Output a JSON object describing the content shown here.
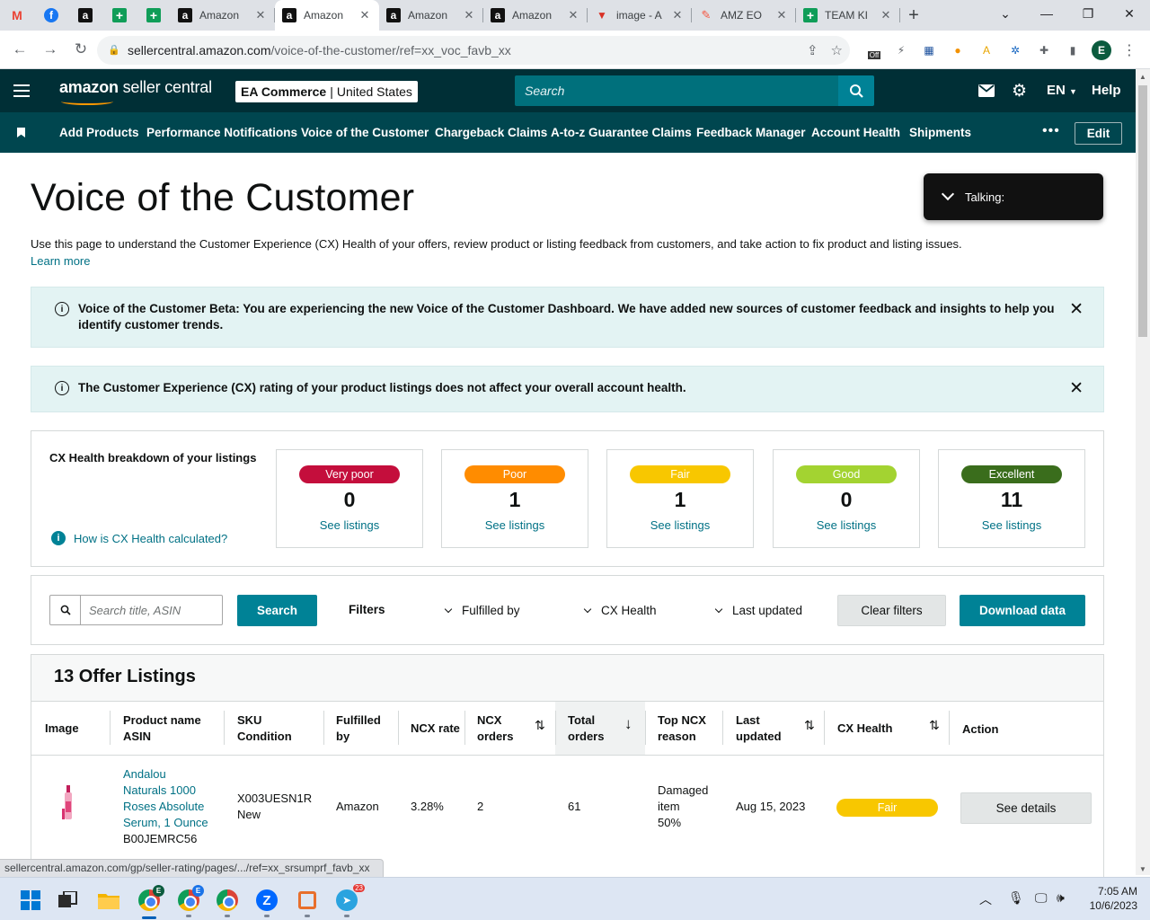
{
  "browser": {
    "tabs": [
      {
        "label": "",
        "icon": "gmail-icon"
      },
      {
        "label": "",
        "icon": "facebook-icon"
      },
      {
        "label": "",
        "icon": "amazon-icon"
      },
      {
        "label": "",
        "icon": "google-sheets-icon"
      },
      {
        "label": "",
        "icon": "google-sheets-icon"
      },
      {
        "label": "Amazon",
        "icon": "amazon-icon"
      },
      {
        "label": "Amazon",
        "icon": "amazon-icon",
        "active": true
      },
      {
        "label": "Amazon",
        "icon": "amazon-icon"
      },
      {
        "label": "Amazon",
        "icon": "amazon-icon"
      },
      {
        "label": "image - A",
        "icon": "vectr-icon"
      },
      {
        "label": "AMZ EO",
        "icon": "amz-icon"
      },
      {
        "label": "TEAM KI",
        "icon": "google-sheets-icon"
      }
    ],
    "url_host": "sellercentral.amazon.com",
    "url_path": "/voice-of-the-customer/ref=xx_voc_favb_xx",
    "profile_initial": "E",
    "extension_badge": "Off",
    "status_url": "sellercentral.amazon.com/gp/seller-rating/pages/.../ref=xx_srsumprf_favb_xx"
  },
  "header": {
    "logo_text_bold": "amazon",
    "logo_text_rest": " seller central",
    "account_name": "EA Commerce",
    "account_region": "United States",
    "search_placeholder": "Search",
    "language": "EN",
    "help_label": "Help"
  },
  "nav": {
    "items": [
      "Add Products",
      "Performance Notifications",
      "Voice of the Customer",
      "Chargeback Claims",
      "A-to-z Guarantee Claims",
      "Feedback Manager",
      "Account Health",
      "Shipments"
    ],
    "more_label": "•••",
    "edit_label": "Edit"
  },
  "page": {
    "title": "Voice of the Customer",
    "intro": "Use this page to understand the Customer Experience (CX) Health of your offers, review product or listing feedback from customers, and take action to fix product and listing issues.",
    "learn_more": "Learn more",
    "talking_label": "Talking:",
    "alert_beta_line1": "Voice of the Customer Beta: You are experiencing the new Voice of the Customer Dashboard. We have added new sources of customer feedback and insights to help you",
    "alert_beta_line2": "identify customer trends.",
    "alert_cx": "The Customer Experience (CX) rating of your product listings does not affect your overall account health."
  },
  "cx_health": {
    "heading": "CX Health breakdown of your listings",
    "how_link": "How is CX Health calculated?",
    "see_label": "See listings",
    "buckets": [
      {
        "label": "Very poor",
        "count": "0",
        "color": "#c40e3c"
      },
      {
        "label": "Poor",
        "count": "1",
        "color": "#ff8c00"
      },
      {
        "label": "Fair",
        "count": "1",
        "color": "#f8c700"
      },
      {
        "label": "Good",
        "count": "0",
        "color": "#a3d331"
      },
      {
        "label": "Excellent",
        "count": "11",
        "color": "#3a6d1c"
      }
    ]
  },
  "filters": {
    "search_placeholder": "Search title, ASIN",
    "search_button": "Search",
    "filters_label": "Filters",
    "fulfilled_by": "Fulfilled by",
    "cx_health": "CX Health",
    "last_updated": "Last updated",
    "clear_button": "Clear filters",
    "download_button": "Download data"
  },
  "table": {
    "title": "13 Offer Listings",
    "columns": {
      "image": "Image",
      "product_name": "Product name",
      "asin": "ASIN",
      "sku": "SKU",
      "condition": "Condition",
      "fulfilled_1": "Fulfilled",
      "fulfilled_2": "by",
      "ncx_rate": "NCX rate",
      "ncx_orders_1": "NCX",
      "ncx_orders_2": "orders",
      "total_orders_1": "Total",
      "total_orders_2": "orders",
      "top_reason_1": "Top NCX",
      "top_reason_2": "reason",
      "last_updated_1": "Last",
      "last_updated_2": "updated",
      "cx_health": "CX Health",
      "action": "Action"
    },
    "rows": [
      {
        "name_lines": [
          "Andalou",
          "Naturals 1000",
          "Roses Absolute",
          "Serum, 1 Ounce"
        ],
        "asin": "B00JEMRC56",
        "sku": "X003UESN1R",
        "condition": "New",
        "fulfilled_by": "Amazon",
        "ncx_rate": "3.28%",
        "ncx_orders": "2",
        "total_orders": "61",
        "top_reason_lines": [
          "Damaged",
          "item",
          "50%"
        ],
        "last_updated": "Aug 15, 2023",
        "cx_health": "Fair",
        "action": "See details"
      }
    ]
  },
  "taskbar": {
    "time": "7:05 AM",
    "date": "10/6/2023",
    "telegram_badge": "23"
  }
}
